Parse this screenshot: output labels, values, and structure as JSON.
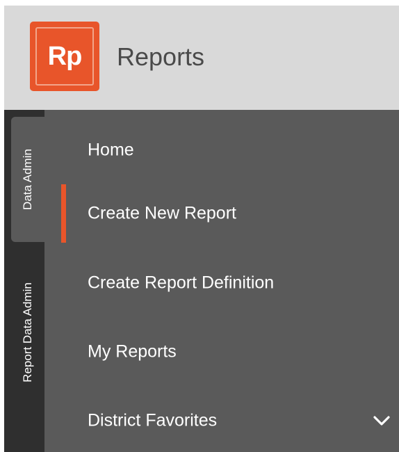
{
  "app": {
    "logo_text": "Rp",
    "title": "Reports"
  },
  "rail": {
    "tabs": [
      {
        "label": "Data Admin",
        "active": true
      },
      {
        "label": "Report Data Admin",
        "active": false
      }
    ]
  },
  "menu": {
    "items": [
      {
        "label": "Home"
      },
      {
        "label": "Create New Report",
        "active": true
      },
      {
        "label": "Create Report Definition"
      },
      {
        "label": "My Reports"
      },
      {
        "label": "District Favorites",
        "expandable": true,
        "icon": "chevron-down-icon"
      }
    ]
  },
  "colors": {
    "accent": "#e8552a",
    "header_bg": "#d9d9d9",
    "menu_bg": "#5a5a5a",
    "rail_bg": "#2f2f2f"
  }
}
